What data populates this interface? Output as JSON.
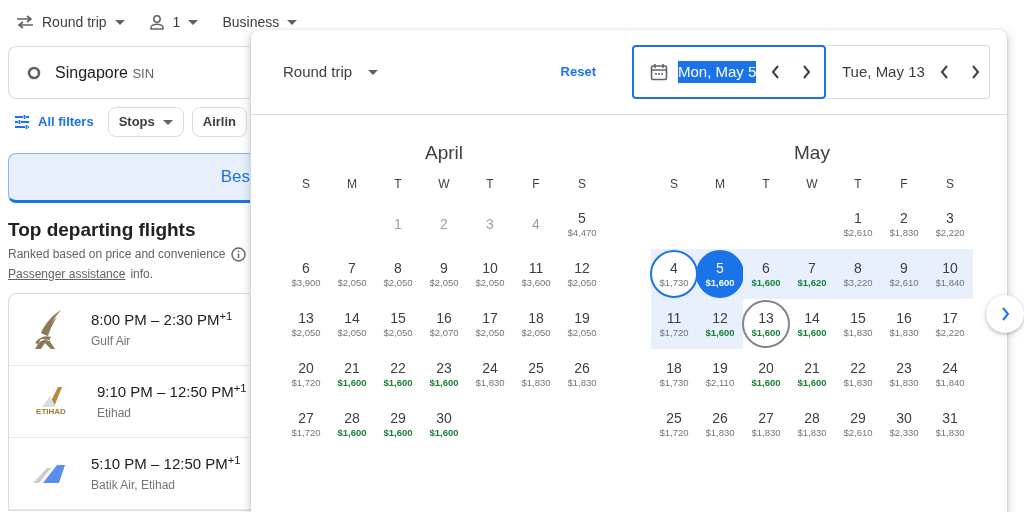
{
  "top_bar": {
    "trip_type": "Round trip",
    "passengers": "1",
    "cabin": "Business"
  },
  "origin": {
    "city": "Singapore",
    "code": "SIN"
  },
  "filters": {
    "all_filters": "All filters",
    "chips": [
      "Stops",
      "Airlin"
    ]
  },
  "sort_tab": {
    "label": "Bes",
    "selected": true
  },
  "section": {
    "title": "Top departing flights",
    "subtitle": "Ranked based on price and convenience",
    "link": "Passenger assistance",
    "link_suffix": "info."
  },
  "flights": [
    {
      "times": "8:00 PM – 2:30 PM$^{+1}$",
      "airline": "Gulf Air",
      "kind": "bird"
    },
    {
      "times": "9:10 PM – 12:50 PM$^{+1}$",
      "airline": "Etihad",
      "kind": "wordmark",
      "logo_text": "ETIHAD"
    },
    {
      "times": "5:10 PM – 12:50 PM$^{+1}$",
      "airline": "Batik Air, Etihad",
      "kind": "tail"
    }
  ],
  "date_picker": {
    "trip_type": "Round trip",
    "reset": "Reset",
    "departure": {
      "value": "Mon, May 5",
      "text_selected": true,
      "focused": true
    },
    "return": {
      "value": "Tue, May 13",
      "text_selected": false,
      "focused": false
    },
    "months": [
      {
        "name": "April",
        "weekdays": [
          "S",
          "M",
          "T",
          "W",
          "T",
          "F",
          "S"
        ],
        "weeks": [
          {
            "starts_mid_week": true,
            "days": [
              {
                "day": "1",
                "disabled": true
              },
              {
                "day": "2",
                "disabled": true
              },
              {
                "day": "3",
                "disabled": true
              },
              {
                "day": "4",
                "disabled": true
              },
              {
                "day": "5",
                "price": "$4,470",
                "cheap": false,
                "disabled": false
              }
            ]
          },
          {
            "days": [
              {
                "day": "6",
                "price": "$3,900",
                "cheap": false,
                "disabled": false
              },
              {
                "day": "7",
                "price": "$2,050",
                "cheap": false,
                "disabled": false
              },
              {
                "day": "8",
                "price": "$2,050",
                "cheap": false,
                "disabled": false
              },
              {
                "day": "9",
                "price": "$2,050",
                "cheap": false,
                "disabled": false
              },
              {
                "day": "10",
                "price": "$2,050",
                "cheap": false,
                "disabled": false
              },
              {
                "day": "11",
                "price": "$3,600",
                "cheap": false,
                "disabled": false
              },
              {
                "day": "12",
                "price": "$2,050",
                "cheap": false,
                "disabled": false
              }
            ]
          },
          {
            "days": [
              {
                "day": "13",
                "price": "$2,050",
                "cheap": false,
                "disabled": false
              },
              {
                "day": "14",
                "price": "$2,050",
                "cheap": false,
                "disabled": false
              },
              {
                "day": "15",
                "price": "$2,050",
                "cheap": false,
                "disabled": false
              },
              {
                "day": "16",
                "price": "$2,070",
                "cheap": false,
                "disabled": false
              },
              {
                "day": "17",
                "price": "$2,050",
                "cheap": false,
                "disabled": false
              },
              {
                "day": "18",
                "price": "$2,050",
                "cheap": false,
                "disabled": false
              },
              {
                "day": "19",
                "price": "$2,050",
                "cheap": false,
                "disabled": false
              }
            ]
          },
          {
            "days": [
              {
                "day": "20",
                "price": "$1,720",
                "cheap": false,
                "disabled": false
              },
              {
                "day": "21",
                "price": "$1,600",
                "cheap": true,
                "disabled": false
              },
              {
                "day": "22",
                "price": "$1,600",
                "cheap": true,
                "disabled": false
              },
              {
                "day": "23",
                "price": "$1,600",
                "cheap": true,
                "disabled": false
              },
              {
                "day": "24",
                "price": "$1,830",
                "cheap": false,
                "disabled": false
              },
              {
                "day": "25",
                "price": "$1,830",
                "cheap": false,
                "disabled": false
              },
              {
                "day": "26",
                "price": "$1,830",
                "cheap": false,
                "disabled": false
              }
            ]
          },
          {
            "starts_mid_week": false,
            "days": [
              {
                "day": "27",
                "price": "$1,720",
                "cheap": false,
                "disabled": false
              },
              {
                "day": "28",
                "price": "$1,600",
                "cheap": true,
                "disabled": false
              },
              {
                "day": "29",
                "price": "$1,600",
                "cheap": true,
                "disabled": false
              },
              {
                "day": "30",
                "price": "$1,600",
                "cheap": true,
                "disabled": false
              }
            ]
          }
        ]
      },
      {
        "name": "May",
        "weekdays": [
          "S",
          "M",
          "T",
          "W",
          "T",
          "F",
          "S"
        ],
        "weeks": [
          {
            "starts_mid_week": true,
            "days": [
              {
                "day": "1",
                "price": "$2,610",
                "cheap": false,
                "selected": false,
                "in_range": false,
                "focused": false,
                "return": false
              },
              {
                "day": "2",
                "price": "$1,830",
                "cheap": false,
                "selected": false,
                "in_range": false,
                "focused": false,
                "return": false
              },
              {
                "day": "3",
                "price": "$2,220",
                "cheap": false,
                "selected": false,
                "in_range": false,
                "focused": false,
                "return": false
              }
            ]
          },
          {
            "days": [
              {
                "day": "4",
                "price": "$1,730",
                "cheap": false,
                "selected": false,
                "in_range": true,
                "focused": true,
                "return": false
              },
              {
                "day": "5",
                "price": "$1,600",
                "cheap": true,
                "selected": true,
                "in_range": true,
                "focused": false,
                "return": false
              },
              {
                "day": "6",
                "price": "$1,600",
                "cheap": true,
                "selected": false,
                "in_range": true,
                "focused": false,
                "return": false
              },
              {
                "day": "7",
                "price": "$1,620",
                "cheap": true,
                "selected": false,
                "in_range": true,
                "focused": false,
                "return": false
              },
              {
                "day": "8",
                "price": "$3,220",
                "cheap": false,
                "selected": false,
                "in_range": true,
                "focused": false,
                "return": false
              },
              {
                "day": "9",
                "price": "$2,610",
                "cheap": false,
                "selected": false,
                "in_range": true,
                "focused": false,
                "return": false
              },
              {
                "day": "10",
                "price": "$1,840",
                "cheap": false,
                "selected": false,
                "in_range": true,
                "focused": false,
                "return": false
              }
            ]
          },
          {
            "days": [
              {
                "day": "11",
                "price": "$1,720",
                "cheap": false,
                "selected": false,
                "in_range": true,
                "focused": false,
                "return": false
              },
              {
                "day": "12",
                "price": "$1,600",
                "cheap": true,
                "selected": false,
                "in_range": true,
                "focused": false,
                "return": false
              },
              {
                "day": "13",
                "price": "$1,600",
                "cheap": true,
                "selected": false,
                "in_range": false,
                "focused": false,
                "return": true
              },
              {
                "day": "14",
                "price": "$1,600",
                "cheap": true,
                "selected": false,
                "in_range": false,
                "focused": false,
                "return": false
              },
              {
                "day": "15",
                "price": "$1,830",
                "cheap": false,
                "selected": false,
                "in_range": false,
                "focused": false,
                "return": false
              },
              {
                "day": "16",
                "price": "$1,830",
                "cheap": false,
                "selected": false,
                "in_range": false,
                "focused": false,
                "return": false
              },
              {
                "day": "17",
                "price": "$2,220",
                "cheap": false,
                "selected": false,
                "in_range": false,
                "focused": false,
                "return": false
              }
            ]
          },
          {
            "days": [
              {
                "day": "18",
                "price": "$1,730",
                "cheap": false,
                "selected": false,
                "in_range": false,
                "focused": false,
                "return": false
              },
              {
                "day": "19",
                "price": "$2,110",
                "cheap": false,
                "selected": false,
                "in_range": false,
                "focused": false,
                "return": false
              },
              {
                "day": "20",
                "price": "$1,600",
                "cheap": true,
                "selected": false,
                "in_range": false,
                "focused": false,
                "return": false
              },
              {
                "day": "21",
                "price": "$1,600",
                "cheap": true,
                "selected": false,
                "in_range": false,
                "focused": false,
                "return": false
              },
              {
                "day": "22",
                "price": "$1,830",
                "cheap": false,
                "selected": false,
                "in_range": false,
                "focused": false,
                "return": false
              },
              {
                "day": "23",
                "price": "$1,830",
                "cheap": false,
                "selected": false,
                "in_range": false,
                "focused": false,
                "return": false
              },
              {
                "day": "24",
                "price": "$1,840",
                "cheap": false,
                "selected": false,
                "in_range": false,
                "focused": false,
                "return": false
              }
            ]
          },
          {
            "days": [
              {
                "day": "25",
                "price": "$1,720",
                "cheap": false,
                "selected": false,
                "in_range": false,
                "focused": false,
                "return": false
              },
              {
                "day": "26",
                "price": "$1,830",
                "cheap": false,
                "selected": false,
                "in_range": false,
                "focused": false,
                "return": false
              },
              {
                "day": "27",
                "price": "$1,830",
                "cheap": false,
                "selected": false,
                "in_range": false,
                "focused": false,
                "return": false
              },
              {
                "day": "28",
                "price": "$1,830",
                "cheap": false,
                "selected": false,
                "in_range": false,
                "focused": false,
                "return": false
              },
              {
                "day": "29",
                "price": "$2,610",
                "cheap": false,
                "selected": false,
                "in_range": false,
                "focused": false,
                "return": false
              },
              {
                "day": "30",
                "price": "$2,330",
                "cheap": false,
                "selected": false,
                "in_range": false,
                "focused": false,
                "return": false
              },
              {
                "day": "31",
                "price": "$1,830",
                "cheap": false,
                "selected": false,
                "in_range": false,
                "focused": false,
                "return": false
              }
            ]
          }
        ]
      }
    ]
  }
}
